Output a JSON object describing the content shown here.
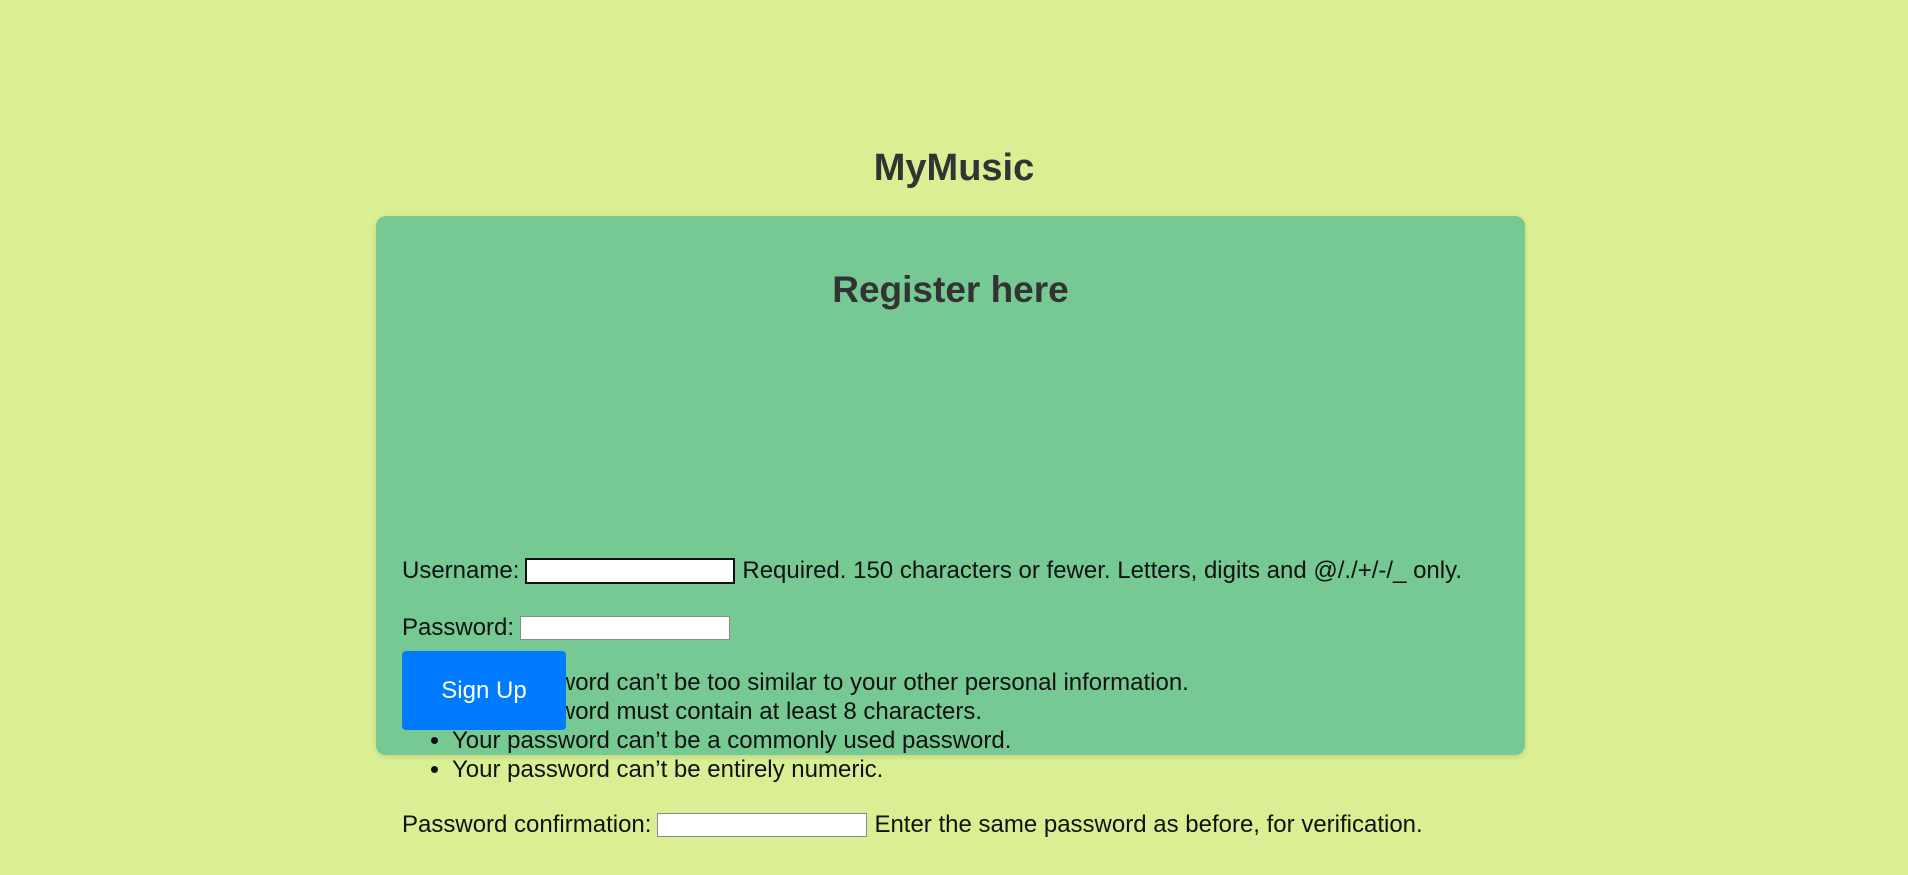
{
  "site": {
    "title": "MyMusic"
  },
  "form": {
    "heading": "Register here",
    "username": {
      "label": "Username:",
      "value": "",
      "help": "Required. 150 characters or fewer. Letters, digits and @/./+/-/_ only."
    },
    "password": {
      "label": "Password:",
      "value": "",
      "rules": [
        "Your password can’t be too similar to your other personal information.",
        "Your password must contain at least 8 characters.",
        "Your password can’t be a commonly used password.",
        "Your password can’t be entirely numeric."
      ]
    },
    "password_confirmation": {
      "label": "Password confirmation:",
      "value": "",
      "help": "Enter the same password as before, for verification."
    },
    "submit_label": "Sign Up"
  },
  "colors": {
    "page_background": "#daef93",
    "card_background": "#76c993",
    "button_background": "#007bff",
    "button_text": "#ffffff",
    "heading_text": "#333333"
  }
}
